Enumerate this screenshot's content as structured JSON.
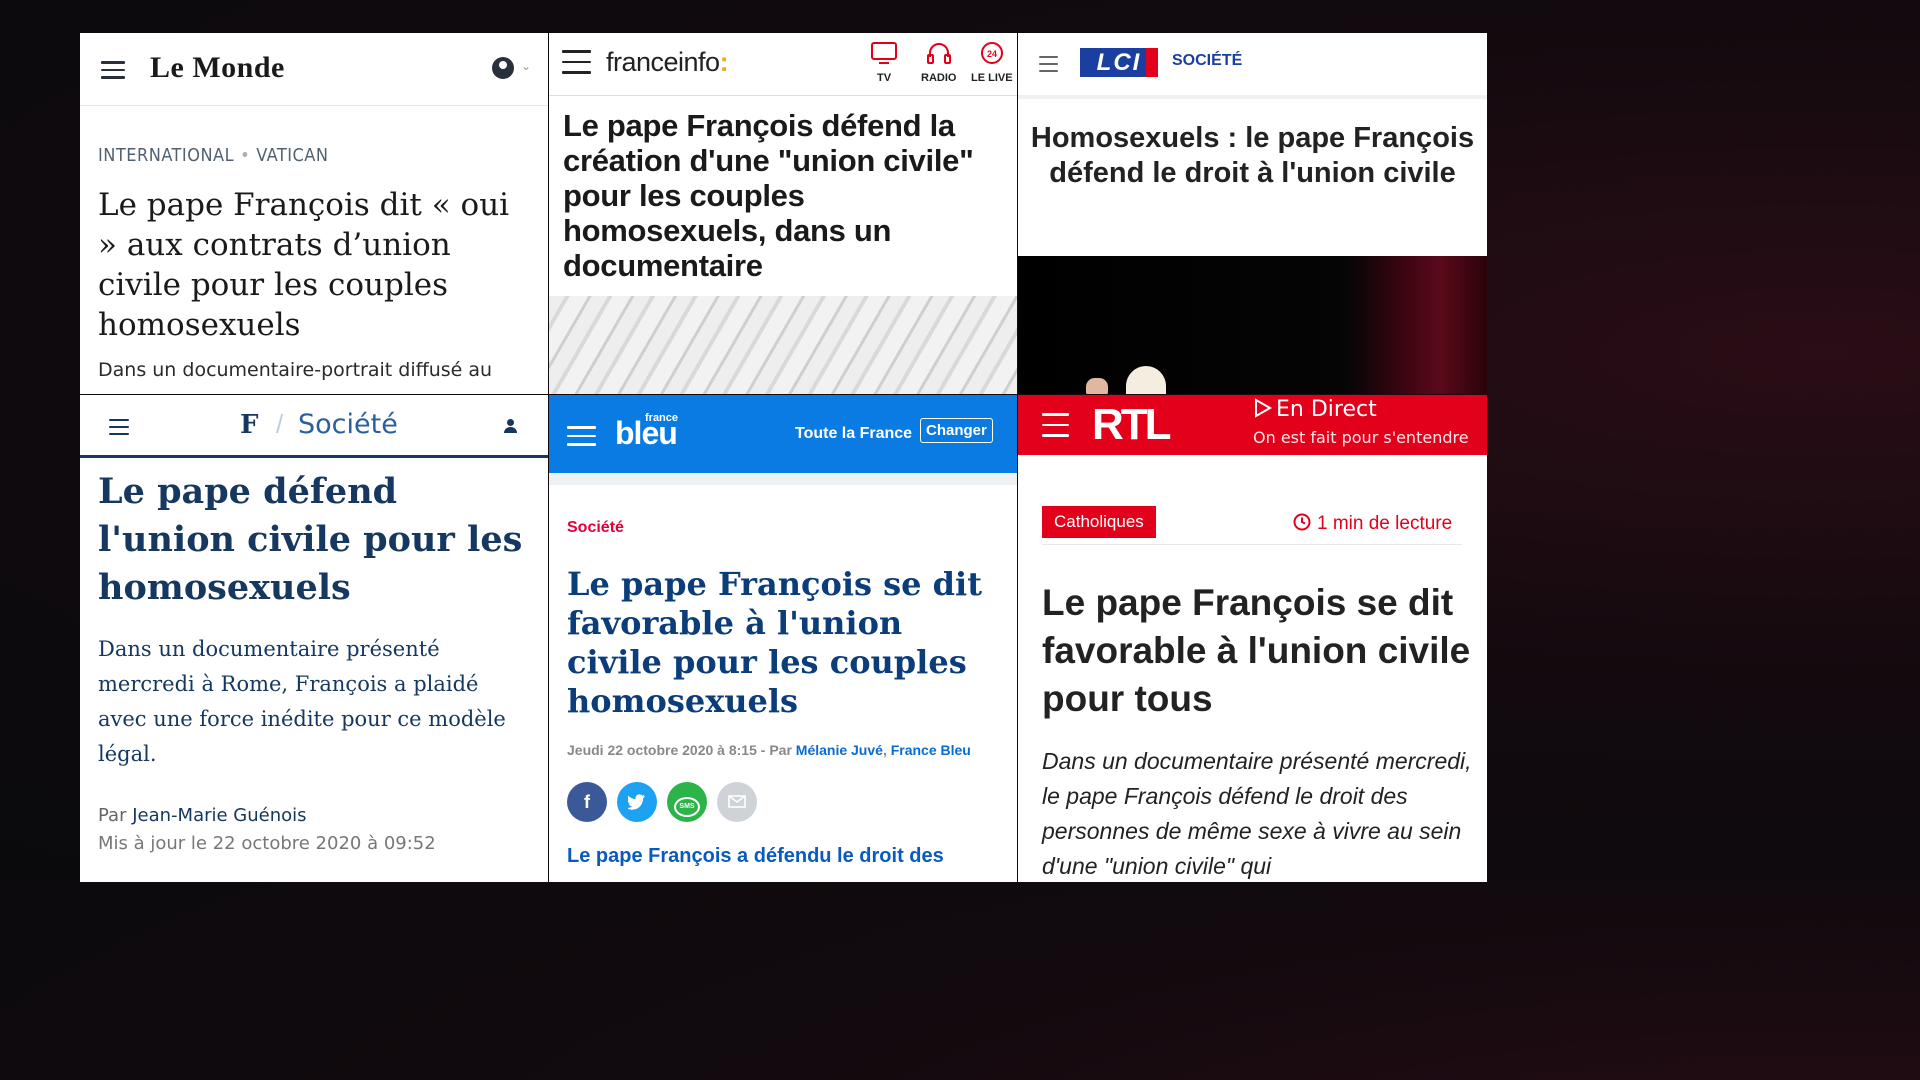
{
  "lemonde": {
    "logo": "Le Monde",
    "kicker_1": "INTERNATIONAL",
    "kicker_sep": "•",
    "kicker_2": "VATICAN",
    "title": "Le pape François dit « oui » aux contrats d’union civile pour les couples homosexuels",
    "lead": "Dans un documentaire-portrait diffusé au"
  },
  "franceinfo": {
    "logo": "franceinfo",
    "logo_colon": ":",
    "nav": [
      "TV",
      "RADIO",
      "LE LIVE"
    ],
    "title": "Le pape François défend la création d'une \"union civile\" pour les couples homosexuels, dans un documentaire"
  },
  "lci": {
    "logo": "LCI",
    "section": "SOCIÉTÉ",
    "title": "Homosexuels : le pape François défend le droit à l'union civile"
  },
  "figaro": {
    "logo": "F",
    "slash": "/",
    "section": "Société",
    "title": "Le pape défend l'union civile pour les homosexuels",
    "lead": "Dans un documentaire présenté mercredi à Rome, François a plaidé avec une force inédite pour ce modèle légal.",
    "by_prefix": "Par",
    "author": "Jean-Marie Guénois",
    "updated": "Mis à jour le 22 octobre 2020 à 09:52"
  },
  "francebleu": {
    "logo_small": "france",
    "logo": "bleu",
    "location": "Toute la France",
    "change": "Changer",
    "section": "Société",
    "title": "Le pape François se dit favorable à l'union civile pour les couples homosexuels",
    "meta_date": "Jeudi 22 octobre 2020 à 8:15 - Par",
    "meta_author": "Mélanie Juvé",
    "meta_sep": ",",
    "meta_outlet": "France Bleu",
    "share_sms": "SMS",
    "lead": "Le pape François a défendu le droit des"
  },
  "rtl": {
    "logo": "RTL",
    "live": "En Direct",
    "tagline": "On est fait pour s'entendre",
    "tag": "Catholiques",
    "read_time": "1 min de lecture",
    "title": "Le pape François se dit favorable à l'union civile pour tous",
    "lead": "Dans un documentaire présenté mercredi, le pape François défend le droit des personnes de même sexe à vivre au sein d'une \"union civile\" qui"
  },
  "colors": {
    "figaro_navy": "#163860",
    "francebleu_blue": "#0a7be2",
    "rtl_red": "#e2001a",
    "lci_blue": "#1b3fa0",
    "franceinfo_accent": "#f5a623"
  }
}
